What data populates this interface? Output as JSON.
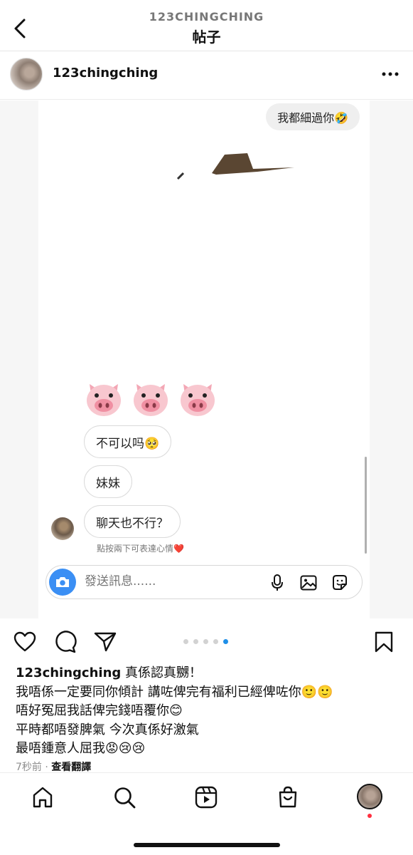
{
  "topnav": {
    "account_name": "123CHINGCHING",
    "title": "帖子"
  },
  "post": {
    "username": "123chingching"
  },
  "chat": {
    "sent_message": "我都細過你🤣",
    "pigs": [
      "🐷",
      "🐷",
      "🐷"
    ],
    "received_messages": [
      "不可以吗🥺",
      "妹妹",
      "聊天也不行？"
    ],
    "reaction_hint": "點按兩下可表達心情❤️",
    "composer_placeholder": "發送訊息......"
  },
  "carousel": {
    "total": 5,
    "active_index": 4
  },
  "caption": {
    "username": "123chingching",
    "first_line": " 真係認真嬲！",
    "lines": [
      "我唔係一定要同你傾計 講咗俾完有福利已經俾咗你🙂🙂",
      "唔好冤屈我話俾完錢唔覆你😊",
      "平時都唔發脾氣 今次真係好激氣",
      "最唔鍾意人屈我😡😢😢"
    ]
  },
  "meta": {
    "time": "7秒前",
    "separator": "·",
    "see_translation": "查看翻譯"
  },
  "icons": {
    "back": "chevron-left-icon",
    "more": "more-horizontal-icon",
    "like": "heart-icon",
    "comment": "comment-icon",
    "share": "send-icon",
    "save": "bookmark-icon",
    "home": "home-icon",
    "search": "search-icon",
    "reels": "reels-icon",
    "shop": "shopping-bag-icon"
  },
  "colors": {
    "accent": "#1f8fe8",
    "camera_button": "#3b8ff4",
    "notification": "#ff3040"
  }
}
